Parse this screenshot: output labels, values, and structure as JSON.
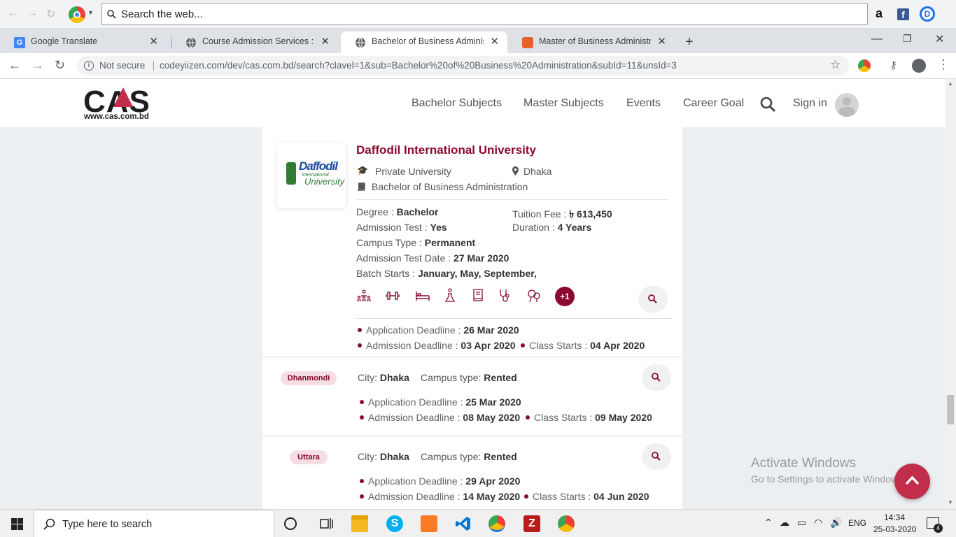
{
  "browser": {
    "search_placeholder": "Search the web...",
    "tabs": [
      {
        "title": "Google Translate"
      },
      {
        "title": "Course Admission Services : Dashboard"
      },
      {
        "title": "Bachelor of Business Administration"
      },
      {
        "title": "Master of Business Administration"
      }
    ],
    "not_secure": "Not secure",
    "url": "codeyiizen.com/dev/cas.com.bd/search?clavel=1&sub=Bachelor%20of%20Business%20Administration&subId=11&unsId=3"
  },
  "site": {
    "logo": "CAS",
    "logo_url": "www.cas.com.bd",
    "nav": [
      "Bachelor Subjects",
      "Master Subjects",
      "Events",
      "Career Goal"
    ],
    "signin": "Sign in"
  },
  "university": {
    "logo_line1": "Daffodil",
    "logo_line2": "International",
    "logo_line3": "University",
    "name": "Daffodil International University",
    "type": "Private University",
    "location": "Dhaka",
    "program": "Bachelor of Business Administration",
    "details": {
      "degree_label": "Degree : ",
      "degree": "Bachelor",
      "fee_label": "Tuition Fee : ",
      "fee": "৳ 613,450",
      "test_label": "Admission Test : ",
      "test": "Yes",
      "duration_label": "Duration : ",
      "duration": "4 Years",
      "campus_label": "Campus Type : ",
      "campus": "Permanent",
      "testdate_label": "Admission Test Date : ",
      "testdate": "27 Mar 2020",
      "batch_label": "Batch Starts : ",
      "batch": "January, May, September,"
    },
    "facilities": [
      "classroom-icon",
      "gym-icon",
      "hostel-bed-icon",
      "lab-icon",
      "library-icon",
      "medical-icon",
      "playground-icon"
    ],
    "more_facilities": "+1",
    "deadlines": {
      "app_label": "Application Deadline : ",
      "app": "26 Mar 2020",
      "adm_label": "Admission Deadline : ",
      "adm": "03 Apr 2020",
      "class_label": "Class Starts : ",
      "class": "04 Apr 2020"
    }
  },
  "campuses": [
    {
      "badge": "Dhanmondi",
      "city_label": "City: ",
      "city": "Dhaka",
      "type_label": "Campus type: ",
      "type": "Rented",
      "app_label": "Application Deadline : ",
      "app": "25 Mar 2020",
      "adm_label": "Admission Deadline : ",
      "adm": "08 May 2020",
      "class_label": "Class Starts : ",
      "class": "09 May 2020"
    },
    {
      "badge": "Uttara",
      "city_label": "City: ",
      "city": "Dhaka",
      "type_label": "Campus type: ",
      "type": "Rented",
      "app_label": "Application Deadline : ",
      "app": "29 Apr 2020",
      "adm_label": "Admission Deadline : ",
      "adm": "14 May 2020",
      "class_label": "Class Starts : ",
      "class": "04 Jun 2020"
    }
  ],
  "windows": {
    "activate_title": "Activate Windows",
    "activate_sub": "Go to Settings to activate Windows.",
    "search_placeholder": "Type here to search",
    "lang": "ENG",
    "time": "14:34",
    "date": "25-03-2020",
    "notifications": "4"
  },
  "colors": {
    "brand": "#8b0a2e",
    "accent": "#c22d4a"
  }
}
